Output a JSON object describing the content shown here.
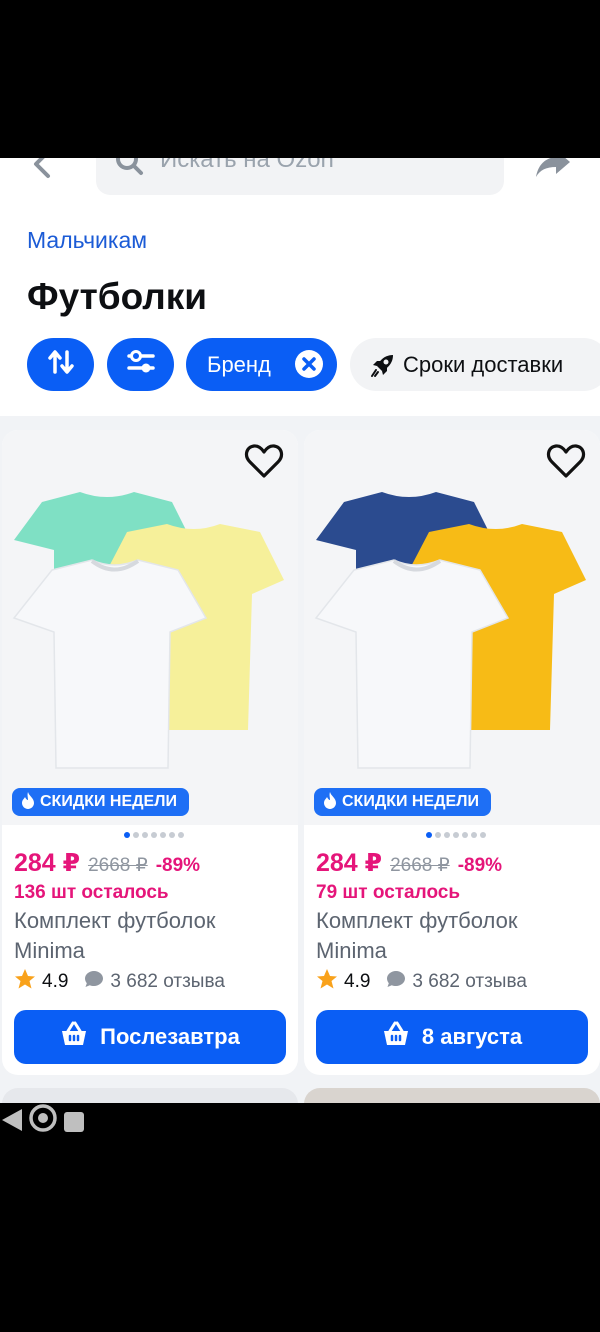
{
  "search": {
    "placeholder": "Искать на Ozon"
  },
  "breadcrumb": "Мальчикам",
  "page_title": "Футболки",
  "filters": {
    "brand_label": "Бренд",
    "delivery_label": "Сроки доставки"
  },
  "products": [
    {
      "badge": "СКИДКИ НЕДЕЛИ",
      "price": "284 ₽",
      "old_price": "2668 ₽",
      "discount": "-89%",
      "stock": "136 шт осталось",
      "name": "Комплект футболок Minima",
      "rating": "4.9",
      "reviews": "3 682 отзыва",
      "button": "Послезавтра",
      "colors": [
        "#7fe0c4",
        "#f6f09a",
        "#f5f6f8"
      ]
    },
    {
      "badge": "СКИДКИ НЕДЕЛИ",
      "price": "284 ₽",
      "old_price": "2668 ₽",
      "discount": "-89%",
      "stock": "79 шт осталось",
      "name": "Комплект футболок Minima",
      "rating": "4.9",
      "reviews": "3 682 отзыва",
      "button": "8 августа",
      "colors": [
        "#2b4b8f",
        "#f7bb16",
        "#f5f6f8"
      ]
    }
  ],
  "colors": {
    "accent": "#0a5ef5",
    "price": "#e5157a",
    "badge": "#1e6ff5"
  }
}
